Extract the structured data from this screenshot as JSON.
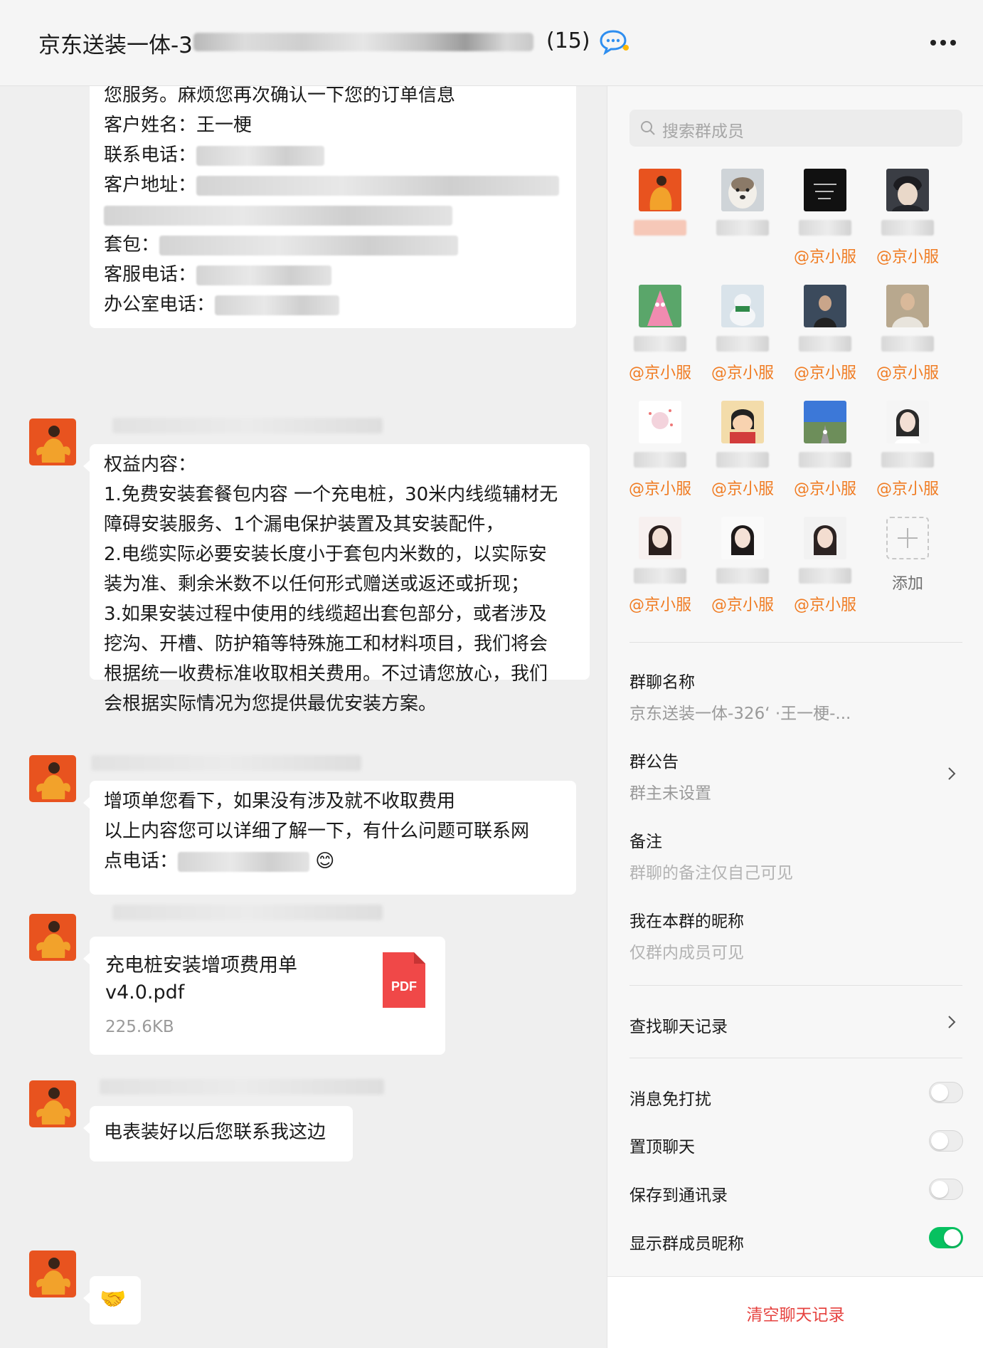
{
  "header": {
    "title": "京东送装一体-3",
    "member_count": "(15)"
  },
  "messages": {
    "m1": {
      "lines": [
        "您服务。麻烦您再次确认一下您的订单信息",
        "客户姓名：王一梗",
        "联系电话：",
        "客户地址：",
        "",
        "套包：",
        "客服电话：",
        "办公室电话："
      ]
    },
    "m2": {
      "lines": [
        "权益内容：",
        "1.免费安装套餐包内容 一个充电桩，30米内线缆辅材无",
        "障碍安装服务、1个漏电保护装置及其安装配件，",
        "2.电缆实际必要安装长度小于套包内米数的，以实际安",
        "装为准、剩余米数不以任何形式赠送或返还或折现；",
        "3.如果安装过程中使用的线缆超出套包部分，或者涉及",
        "挖沟、开槽、防护箱等特殊施工和材料项目，我们将会",
        "根据统一收费标准收取相关费用。不过请您放心，我们",
        "会根据实际情况为您提供最优安装方案。"
      ]
    },
    "m3": {
      "lines": [
        "增项单您看下，如果没有涉及就不收取费用",
        "以上内容您可以详细了解一下，有什么问题可联系网",
        "点电话："
      ],
      "emoji": "😊"
    },
    "m4": {
      "file_name_line1": "充电桩安装增项费用单",
      "file_name_line2": "v4.0.pdf",
      "file_size": "225.6KB",
      "file_type": "PDF"
    },
    "m5": {
      "text": "电表装好以后您联系我这边"
    },
    "m6": {
      "emoji": "🤝"
    }
  },
  "panel": {
    "search_placeholder": "搜索群成员",
    "member_tag": "@京小服",
    "add_label": "添加",
    "group_name_label": "群聊名称",
    "group_name_value": "京东送装一体-326‘              ·王一梗-...",
    "announcement_label": "群公告",
    "announcement_value": "群主未设置",
    "remark_label": "备注",
    "remark_placeholder": "群聊的备注仅自己可见",
    "nickname_label": "我在本群的昵称",
    "nickname_value": "仅群内成员可见",
    "find_history": "查找聊天记录",
    "mute": "消息免打扰",
    "pin": "置顶聊天",
    "save_contacts": "保存到通讯录",
    "show_nicknames": "显示群成员昵称",
    "toggles": {
      "mute": false,
      "pin": false,
      "save_contacts": false,
      "show_nicknames": true
    },
    "clear_history": "清空聊天记录"
  },
  "colors": {
    "accent_green": "#07c160",
    "tag_orange": "#f07c23",
    "danger_red": "#e64340",
    "pdf_red": "#f04848"
  },
  "icons": [
    "chat-bubble-icon",
    "more-icon",
    "search-icon",
    "pdf-icon",
    "chevron-right-icon",
    "add-member-icon"
  ]
}
